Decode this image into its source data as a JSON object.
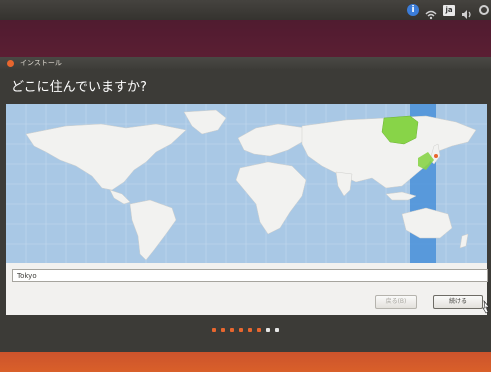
{
  "panel": {
    "icons": [
      "accessibility-icon",
      "network-icon",
      "keyboard-layout-icon",
      "volume-icon",
      "settings-gear-icon"
    ],
    "keyboard_label": "ja"
  },
  "window": {
    "title": "インストール",
    "heading": "どこに住んでいますか?"
  },
  "timezone": {
    "city_value": "Tokyo",
    "highlight_color": "#4a90d9",
    "selected_region_color": "#88d448"
  },
  "buttons": {
    "back_label": "戻る(B)",
    "next_label": "続ける"
  },
  "progress": {
    "completed_steps": 6,
    "total_steps": 8
  },
  "colors": {
    "accent": "#e8662e",
    "ocean": "#a9c8e5",
    "land": "#f2f2f0",
    "window_bg": "#3c3b37"
  }
}
